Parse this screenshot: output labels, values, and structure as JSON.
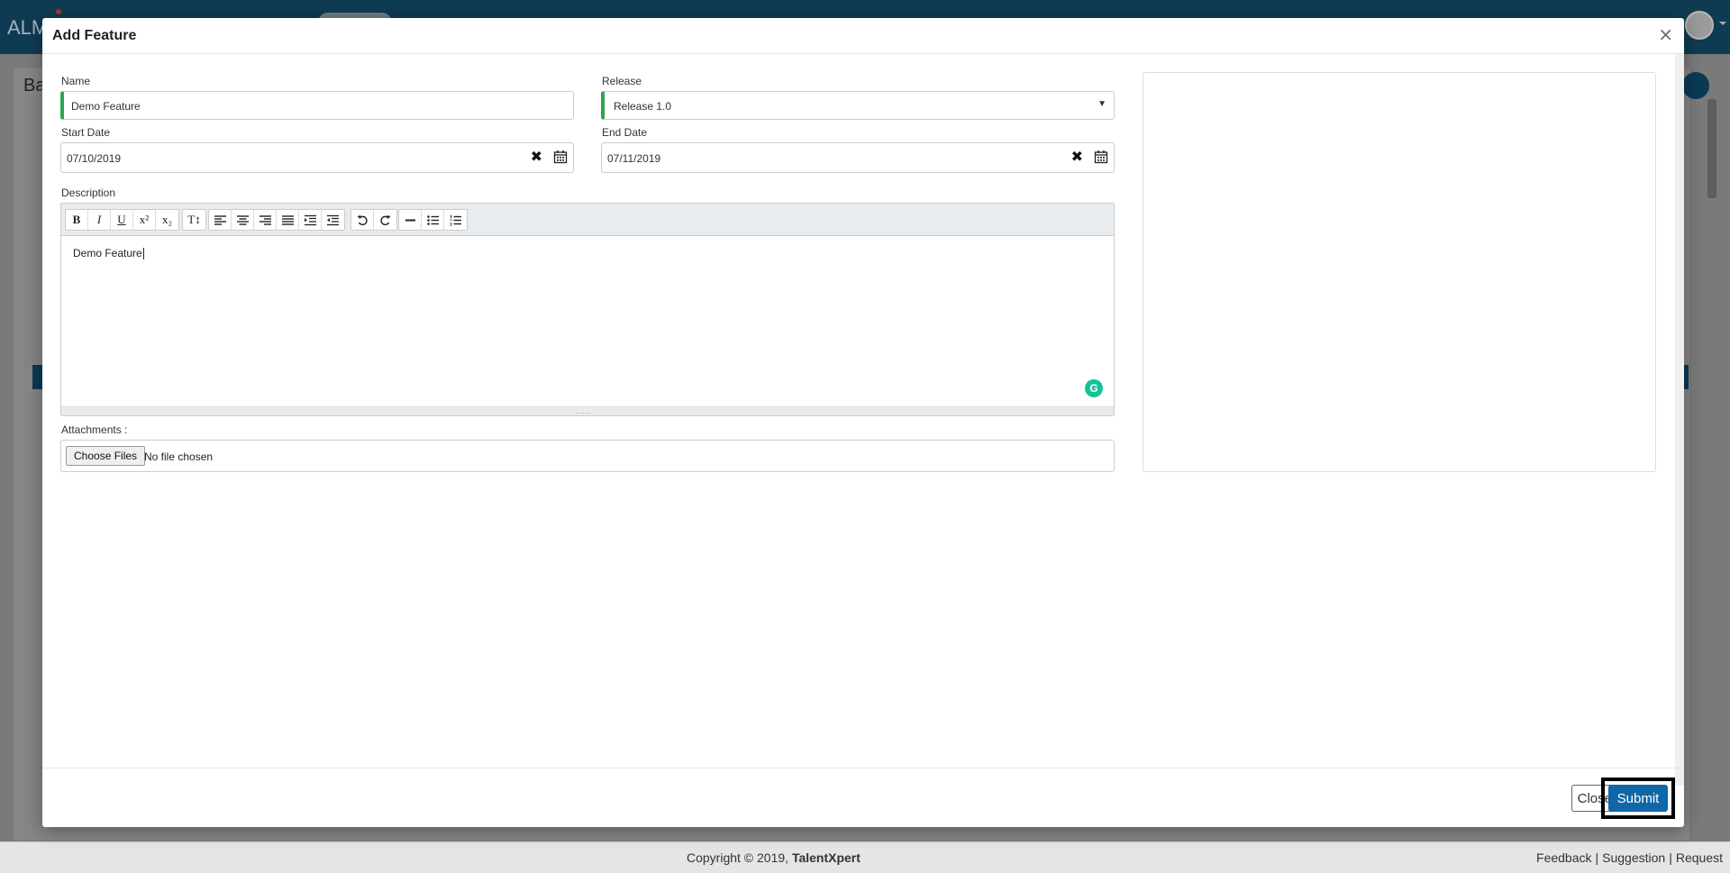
{
  "app": {
    "logo": "ALM",
    "page_title": "Ba"
  },
  "modal": {
    "title": "Add Feature",
    "close_symbol": "×",
    "name": {
      "label": "Name",
      "value": "Demo Feature"
    },
    "release": {
      "label": "Release",
      "value": "Release 1.0"
    },
    "start_date": {
      "label": "Start Date",
      "value": "07/10/2019"
    },
    "end_date": {
      "label": "End Date",
      "value": "07/11/2019"
    },
    "description": {
      "label": "Description",
      "text": "Demo Feature",
      "toolbar": [
        "bold",
        "italic",
        "underline",
        "superscript",
        "subscript",
        "font-size",
        "align-left",
        "align-center",
        "align-right",
        "justify",
        "indent",
        "outdent",
        "undo",
        "redo",
        "horizontal-rule",
        "bulleted-list",
        "numbered-list"
      ]
    },
    "attachments": {
      "label": "Attachments :",
      "button_label": "Choose Files",
      "status": "No file chosen"
    },
    "footer": {
      "close_label": "Close",
      "submit_label": "Submit"
    }
  },
  "footer": {
    "copyright_prefix": "Copyright © 2019,",
    "company": "TalentXpert",
    "links": [
      "Feedback",
      "Suggestion",
      "Request"
    ]
  },
  "colors": {
    "header": "#0f3b52",
    "submit": "#1067a8",
    "required_marker": "#2ea44f",
    "grammarly": "#15c39a"
  }
}
